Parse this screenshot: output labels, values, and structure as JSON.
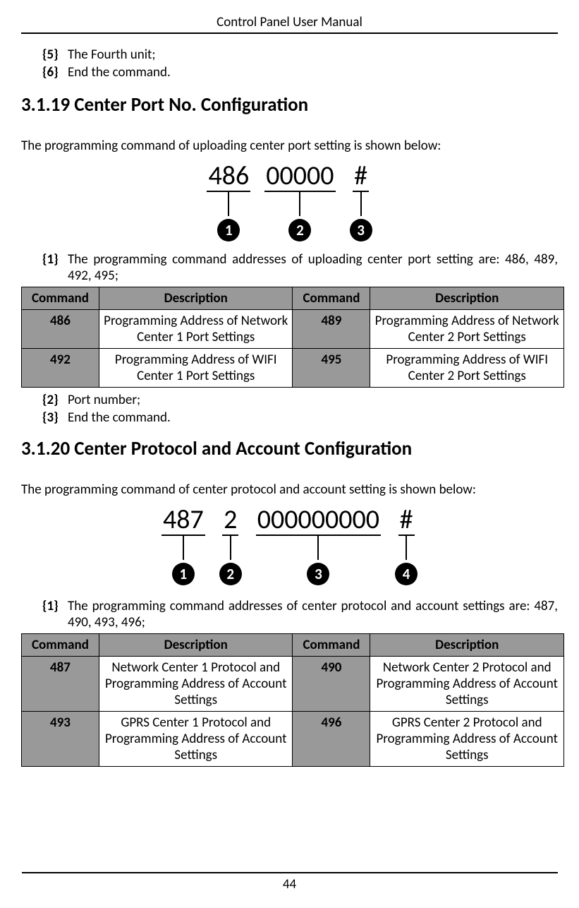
{
  "header": {
    "title": "Control Panel User Manual"
  },
  "topList": {
    "items": [
      {
        "marker": "{5}",
        "text": "The Fourth unit;"
      },
      {
        "marker": "{6}",
        "text": "End the command."
      }
    ]
  },
  "section1": {
    "heading": "3.1.19 Center Port No. Configuration",
    "intro": "The programming command of uploading center port setting is shown below:",
    "diagram": {
      "segments": [
        {
          "text": "486",
          "num": "1"
        },
        {
          "text": "00000",
          "num": "2"
        },
        {
          "text": "#",
          "num": "3"
        }
      ]
    },
    "explain1": {
      "marker": "{1}",
      "text": "The programming command addresses of uploading center port setting are: 486, 489, 492, 495;"
    },
    "table": {
      "headers": [
        "Command",
        "Description",
        "Command",
        "Description"
      ],
      "rows": [
        [
          "486",
          "Programming Address of Network Center 1 Port Settings",
          "489",
          "Programming Address of Network Center 2 Port Settings"
        ],
        [
          "492",
          "Programming Address of WIFI Center 1 Port Settings",
          "495",
          "Programming Address of WIFI Center 2 Port Settings"
        ]
      ]
    },
    "postList": {
      "items": [
        {
          "marker": "{2}",
          "text": "Port number;"
        },
        {
          "marker": "{3}",
          "text": "End the command."
        }
      ]
    }
  },
  "section2": {
    "heading": "3.1.20 Center Protocol and Account Configuration",
    "intro": "The programming command of center protocol and account setting is shown below:",
    "diagram": {
      "segments": [
        {
          "text": "487",
          "num": "1"
        },
        {
          "text": "2",
          "num": "2"
        },
        {
          "text": "000000000",
          "num": "3"
        },
        {
          "text": "#",
          "num": "4"
        }
      ]
    },
    "explain1": {
      "marker": "{1}",
      "text": "The programming command addresses of center protocol and account settings are: 487, 490, 493, 496;"
    },
    "table": {
      "headers": [
        "Command",
        "Description",
        "Command",
        "Description"
      ],
      "rows": [
        [
          "487",
          "Network Center 1 Protocol and Programming Address of Account Settings",
          "490",
          "Network Center 2 Protocol and Programming Address of Account Settings"
        ],
        [
          "493",
          "GPRS Center 1 Protocol and Programming Address of Account Settings",
          "496",
          "GPRS Center 2 Protocol and Programming Address of Account Settings"
        ]
      ]
    }
  },
  "pageNumber": "44"
}
